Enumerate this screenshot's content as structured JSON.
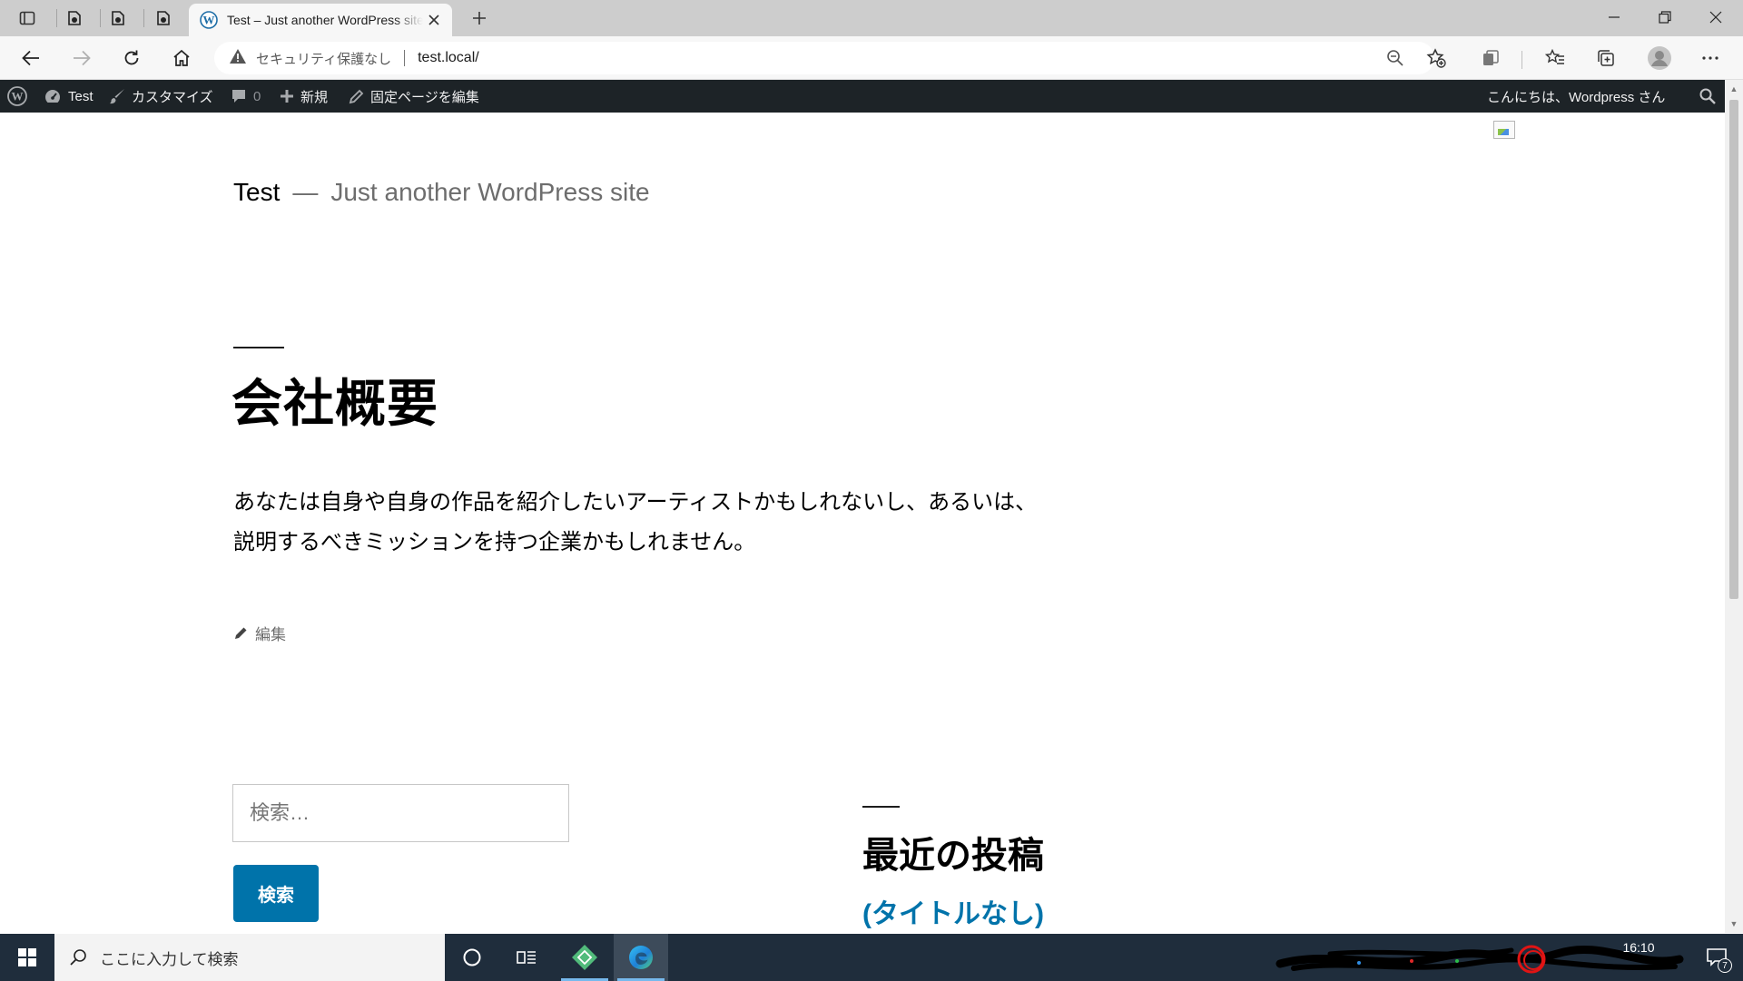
{
  "browser": {
    "tab": {
      "title": "Test – Just another WordPress site",
      "favicon": "wordpress-icon"
    },
    "address": {
      "security_label": "セキュリティ保護なし",
      "url": "test.local/"
    },
    "icons": [
      "tab-actions-icon",
      "workspace-icon",
      "back-icon",
      "forward-icon",
      "refresh-icon",
      "home-icon",
      "warning-icon",
      "zoom-out-icon",
      "add-favorite-icon",
      "extensions-icon",
      "favorites-icon",
      "collections-icon",
      "profile-icon",
      "more-icon"
    ]
  },
  "admin_bar": {
    "site_name": "Test",
    "customize_label": "カスタマイズ",
    "comments_count": "0",
    "new_label": "新規",
    "edit_page_label": "固定ページを編集",
    "greeting": "こんにちは、Wordpress さん"
  },
  "site": {
    "title": "Test",
    "separator": "—",
    "description": "Just another WordPress site"
  },
  "page": {
    "heading": "会社概要",
    "body_lines": [
      "あなたは自身や自身の作品を紹介したいアーティストかもしれないし、あるいは、",
      "説明するべきミッションを持つ企業かもしれません。"
    ],
    "edit_label": "編集"
  },
  "search_widget": {
    "placeholder": "検索…",
    "button_label": "検索"
  },
  "recent_posts_widget": {
    "title": "最近の投稿",
    "posts": [
      "(タイトルなし)"
    ]
  },
  "taskbar": {
    "search_placeholder": "ここに入力して検索",
    "time": "16:10",
    "notification_count": "7"
  },
  "colors": {
    "admin_bar_bg": "#1d2327",
    "link_blue": "#0073aa",
    "taskbar_bg": "#1f2d3c"
  }
}
